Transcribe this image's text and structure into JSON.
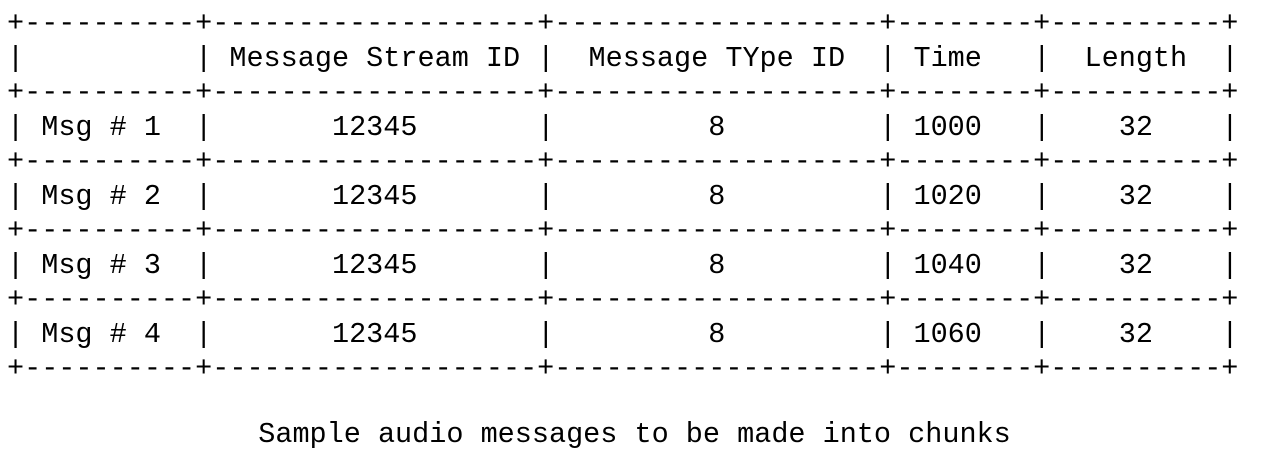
{
  "table": {
    "columns": [
      {
        "header": "",
        "width": 10,
        "align": "center"
      },
      {
        "header": "Message Stream ID",
        "width": 19,
        "align": "center"
      },
      {
        "header": "Message TYpe ID",
        "width": 19,
        "align": "center"
      },
      {
        "header": "Time",
        "width": 8,
        "align": "left"
      },
      {
        "header": "Length",
        "width": 10,
        "align": "center"
      }
    ],
    "rows": [
      [
        "Msg # 1",
        "12345",
        "8",
        "1000",
        "32"
      ],
      [
        "Msg # 2",
        "12345",
        "8",
        "1020",
        "32"
      ],
      [
        "Msg # 3",
        "12345",
        "8",
        "1040",
        "32"
      ],
      [
        "Msg # 4",
        "12345",
        "8",
        "1060",
        "32"
      ]
    ]
  },
  "caption": "Sample audio messages to be made into chunks"
}
